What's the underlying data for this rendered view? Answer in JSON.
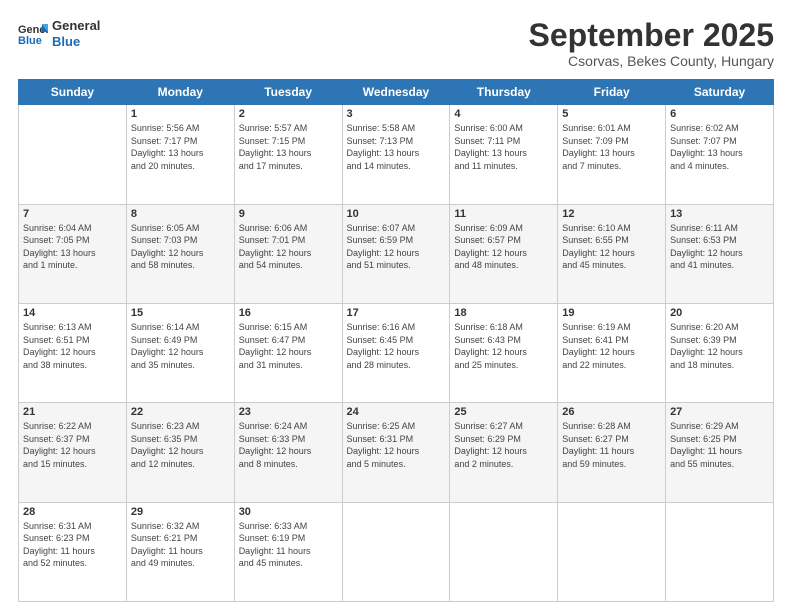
{
  "logo": {
    "line1": "General",
    "line2": "Blue"
  },
  "header": {
    "month": "September 2025",
    "location": "Csorvas, Bekes County, Hungary"
  },
  "weekdays": [
    "Sunday",
    "Monday",
    "Tuesday",
    "Wednesday",
    "Thursday",
    "Friday",
    "Saturday"
  ],
  "weeks": [
    [
      {
        "day": "",
        "info": ""
      },
      {
        "day": "1",
        "info": "Sunrise: 5:56 AM\nSunset: 7:17 PM\nDaylight: 13 hours\nand 20 minutes."
      },
      {
        "day": "2",
        "info": "Sunrise: 5:57 AM\nSunset: 7:15 PM\nDaylight: 13 hours\nand 17 minutes."
      },
      {
        "day": "3",
        "info": "Sunrise: 5:58 AM\nSunset: 7:13 PM\nDaylight: 13 hours\nand 14 minutes."
      },
      {
        "day": "4",
        "info": "Sunrise: 6:00 AM\nSunset: 7:11 PM\nDaylight: 13 hours\nand 11 minutes."
      },
      {
        "day": "5",
        "info": "Sunrise: 6:01 AM\nSunset: 7:09 PM\nDaylight: 13 hours\nand 7 minutes."
      },
      {
        "day": "6",
        "info": "Sunrise: 6:02 AM\nSunset: 7:07 PM\nDaylight: 13 hours\nand 4 minutes."
      }
    ],
    [
      {
        "day": "7",
        "info": "Sunrise: 6:04 AM\nSunset: 7:05 PM\nDaylight: 13 hours\nand 1 minute."
      },
      {
        "day": "8",
        "info": "Sunrise: 6:05 AM\nSunset: 7:03 PM\nDaylight: 12 hours\nand 58 minutes."
      },
      {
        "day": "9",
        "info": "Sunrise: 6:06 AM\nSunset: 7:01 PM\nDaylight: 12 hours\nand 54 minutes."
      },
      {
        "day": "10",
        "info": "Sunrise: 6:07 AM\nSunset: 6:59 PM\nDaylight: 12 hours\nand 51 minutes."
      },
      {
        "day": "11",
        "info": "Sunrise: 6:09 AM\nSunset: 6:57 PM\nDaylight: 12 hours\nand 48 minutes."
      },
      {
        "day": "12",
        "info": "Sunrise: 6:10 AM\nSunset: 6:55 PM\nDaylight: 12 hours\nand 45 minutes."
      },
      {
        "day": "13",
        "info": "Sunrise: 6:11 AM\nSunset: 6:53 PM\nDaylight: 12 hours\nand 41 minutes."
      }
    ],
    [
      {
        "day": "14",
        "info": "Sunrise: 6:13 AM\nSunset: 6:51 PM\nDaylight: 12 hours\nand 38 minutes."
      },
      {
        "day": "15",
        "info": "Sunrise: 6:14 AM\nSunset: 6:49 PM\nDaylight: 12 hours\nand 35 minutes."
      },
      {
        "day": "16",
        "info": "Sunrise: 6:15 AM\nSunset: 6:47 PM\nDaylight: 12 hours\nand 31 minutes."
      },
      {
        "day": "17",
        "info": "Sunrise: 6:16 AM\nSunset: 6:45 PM\nDaylight: 12 hours\nand 28 minutes."
      },
      {
        "day": "18",
        "info": "Sunrise: 6:18 AM\nSunset: 6:43 PM\nDaylight: 12 hours\nand 25 minutes."
      },
      {
        "day": "19",
        "info": "Sunrise: 6:19 AM\nSunset: 6:41 PM\nDaylight: 12 hours\nand 22 minutes."
      },
      {
        "day": "20",
        "info": "Sunrise: 6:20 AM\nSunset: 6:39 PM\nDaylight: 12 hours\nand 18 minutes."
      }
    ],
    [
      {
        "day": "21",
        "info": "Sunrise: 6:22 AM\nSunset: 6:37 PM\nDaylight: 12 hours\nand 15 minutes."
      },
      {
        "day": "22",
        "info": "Sunrise: 6:23 AM\nSunset: 6:35 PM\nDaylight: 12 hours\nand 12 minutes."
      },
      {
        "day": "23",
        "info": "Sunrise: 6:24 AM\nSunset: 6:33 PM\nDaylight: 12 hours\nand 8 minutes."
      },
      {
        "day": "24",
        "info": "Sunrise: 6:25 AM\nSunset: 6:31 PM\nDaylight: 12 hours\nand 5 minutes."
      },
      {
        "day": "25",
        "info": "Sunrise: 6:27 AM\nSunset: 6:29 PM\nDaylight: 12 hours\nand 2 minutes."
      },
      {
        "day": "26",
        "info": "Sunrise: 6:28 AM\nSunset: 6:27 PM\nDaylight: 11 hours\nand 59 minutes."
      },
      {
        "day": "27",
        "info": "Sunrise: 6:29 AM\nSunset: 6:25 PM\nDaylight: 11 hours\nand 55 minutes."
      }
    ],
    [
      {
        "day": "28",
        "info": "Sunrise: 6:31 AM\nSunset: 6:23 PM\nDaylight: 11 hours\nand 52 minutes."
      },
      {
        "day": "29",
        "info": "Sunrise: 6:32 AM\nSunset: 6:21 PM\nDaylight: 11 hours\nand 49 minutes."
      },
      {
        "day": "30",
        "info": "Sunrise: 6:33 AM\nSunset: 6:19 PM\nDaylight: 11 hours\nand 45 minutes."
      },
      {
        "day": "",
        "info": ""
      },
      {
        "day": "",
        "info": ""
      },
      {
        "day": "",
        "info": ""
      },
      {
        "day": "",
        "info": ""
      }
    ]
  ]
}
